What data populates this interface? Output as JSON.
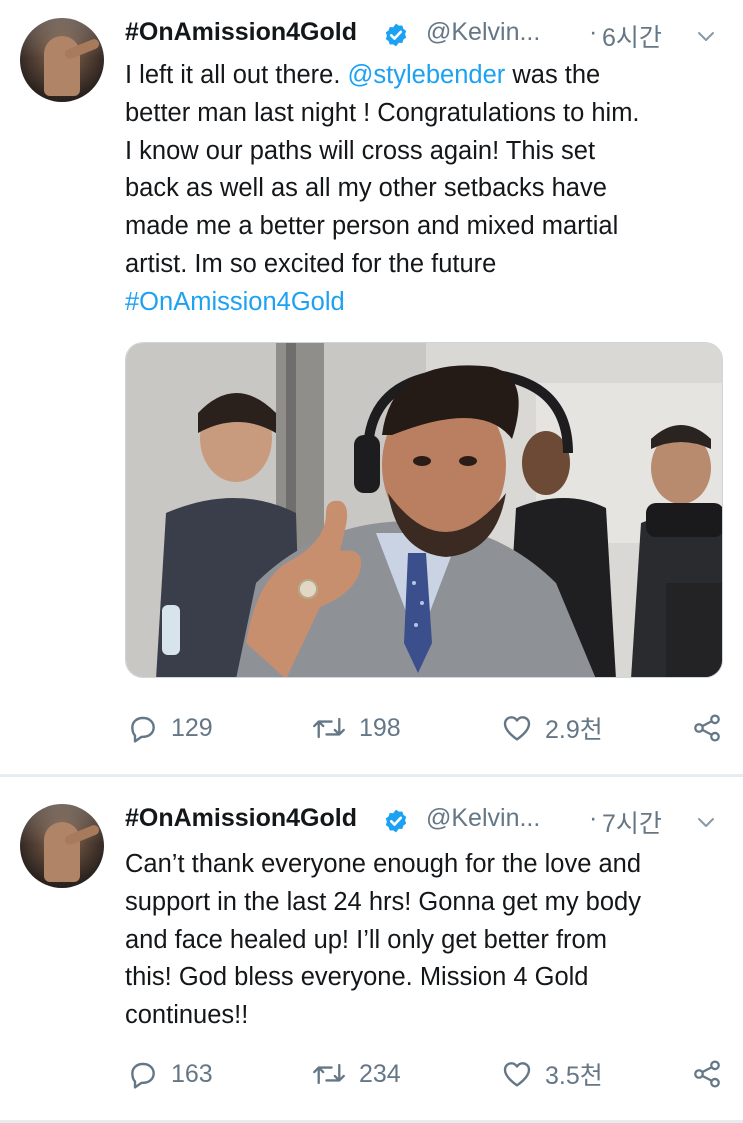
{
  "colors": {
    "link": "#1da1f2",
    "verified": "#1da1f2",
    "secondary_text": "#657786",
    "divider": "#e6ecf0"
  },
  "tweets": [
    {
      "author_name": "#OnAmission4Gold",
      "handle": "@Kelvin...",
      "separator": "·",
      "time": "6시간",
      "verified_icon": "verified-badge-icon",
      "text_lines": [
        {
          "segments": [
            {
              "text": "I left it all out there. ",
              "link": false
            },
            {
              "text": "@stylebender",
              "link": true
            },
            {
              "text": " was the",
              "link": false
            }
          ]
        },
        {
          "segments": [
            {
              "text": "better man last night ! Congratulations to him.",
              "link": false
            }
          ]
        },
        {
          "segments": [
            {
              "text": "I know our paths will cross again! This set",
              "link": false
            }
          ]
        },
        {
          "segments": [
            {
              "text": "back as well as all my other setbacks have",
              "link": false
            }
          ]
        },
        {
          "segments": [
            {
              "text": "made me a better person and mixed martial",
              "link": false
            }
          ]
        },
        {
          "segments": [
            {
              "text": "artist. Im so excited for the future",
              "link": false
            }
          ]
        },
        {
          "segments": [
            {
              "text": "#OnAmission4Gold",
              "link": true
            }
          ]
        }
      ],
      "media": {
        "kind": "photo",
        "description_icon": "photo-man-in-suit-pointing"
      },
      "stats": {
        "replies": "129",
        "retweets": "198",
        "likes": "2.9천"
      }
    },
    {
      "author_name": "#OnAmission4Gold",
      "handle": "@Kelvin...",
      "separator": "·",
      "time": "7시간",
      "verified_icon": "verified-badge-icon",
      "text_lines": [
        {
          "segments": [
            {
              "text": "Can’t thank everyone enough for the love and",
              "link": false
            }
          ]
        },
        {
          "segments": [
            {
              "text": "support in the last 24 hrs! Gonna get my body",
              "link": false
            }
          ]
        },
        {
          "segments": [
            {
              "text": "and face healed up! I’ll only get better from",
              "link": false
            }
          ]
        },
        {
          "segments": [
            {
              "text": "this! God bless everyone. Mission 4 Gold",
              "link": false
            }
          ]
        },
        {
          "segments": [
            {
              "text": "continues!!",
              "link": false
            }
          ]
        }
      ],
      "media": null,
      "stats": {
        "replies": "163",
        "retweets": "234",
        "likes": "3.5천"
      }
    }
  ]
}
